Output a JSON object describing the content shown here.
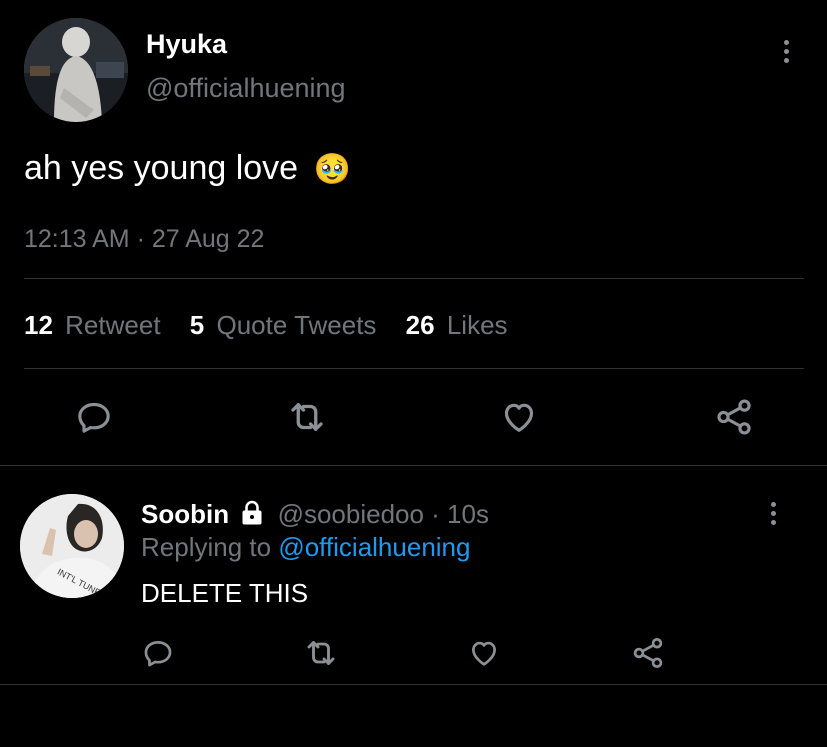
{
  "main_tweet": {
    "display_name": "Hyuka",
    "handle": "@officialhuening",
    "text": "ah yes young love",
    "emoji": "🥹",
    "timestamp": "12:13 AM · 27 Aug 22",
    "stats": {
      "retweet_count": "12",
      "retweet_label": "Retweet",
      "quote_count": "5",
      "quote_label": "Quote Tweets",
      "like_count": "26",
      "like_label": "Likes"
    }
  },
  "reply": {
    "display_name": "Soobin",
    "handle_time": "@soobiedoo · 10s",
    "replying_prefix": "Replying to",
    "replying_to": "@officialhuening",
    "text": "DELETE THIS"
  },
  "icons": [
    "reply-icon",
    "retweet-icon",
    "like-icon",
    "share-icon",
    "lock-icon",
    "more-icon"
  ],
  "colors": {
    "background": "#000000",
    "text": "#ffffff",
    "secondary": "#71767b",
    "link": "#1d9bf0",
    "divider": "#2f3336"
  }
}
